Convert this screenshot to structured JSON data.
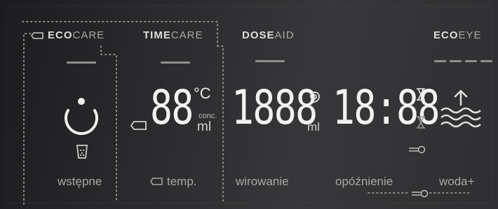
{
  "programs": {
    "ecocare": {
      "bold": "ECO",
      "light": "CARE"
    },
    "timecare": {
      "bold": "TIME",
      "light": "CARE"
    },
    "doseaid": {
      "bold": "DOSE",
      "light": "AID"
    },
    "ecoeye": {
      "bold": "ECO",
      "light": "EYE"
    }
  },
  "displays": {
    "temp_digits": "88",
    "temp_unit": "°C",
    "conc_label": "conc.",
    "ml_unit": "ml",
    "spin_digits": "1888",
    "spin_unit": "ml",
    "time_digits": "18:88"
  },
  "labels": {
    "prewash": "wstępne",
    "temp": "temp.",
    "spin": "wirowanie",
    "delay": "opóźnienie",
    "water_plus": "woda+"
  },
  "icons": {
    "power": "power-icon",
    "detergent": "detergent-cup-icon",
    "lock": "lock-tab-icon",
    "spiral": "spiral-icon",
    "hourglass": "hourglass-icon",
    "key": "key-icon",
    "water": "water-level-icon"
  },
  "colors": {
    "background": "#2a2a2c",
    "text_bright": "#f2f2f2",
    "text_dim": "#a8a8a8"
  }
}
